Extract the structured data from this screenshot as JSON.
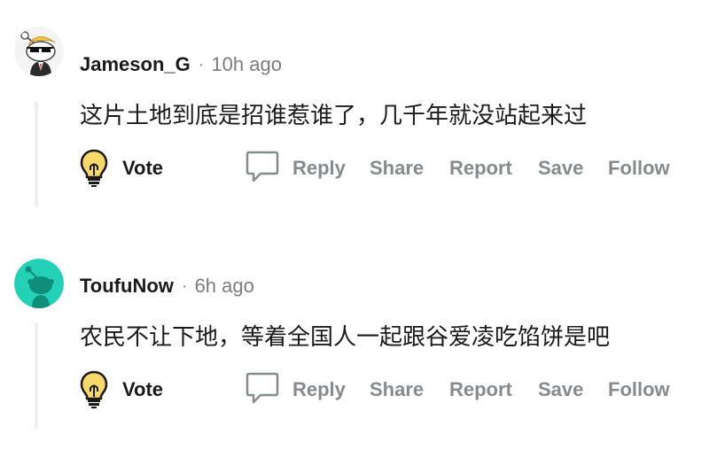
{
  "comments": [
    {
      "username": "Jameson_G",
      "separator": "·",
      "time": "10h ago",
      "text": "这片土地到底是招谁惹谁了，几千年就没站起来过",
      "avatar": "snoo-avatar-sunglasses",
      "actions": {
        "vote": "Vote",
        "reply": "Reply",
        "share": "Share",
        "report": "Report",
        "save": "Save",
        "follow": "Follow"
      }
    },
    {
      "username": "ToufuNow",
      "separator": "·",
      "time": "6h ago",
      "text": "农民不让下地，等着全国人一起跟谷爱凌吃馅饼是吧",
      "avatar": "snoo-avatar-teal",
      "actions": {
        "vote": "Vote",
        "reply": "Reply",
        "share": "Share",
        "report": "Report",
        "save": "Save",
        "follow": "Follow"
      }
    }
  ],
  "colors": {
    "text": "#1a1a1b",
    "muted": "#878a8c",
    "thread_line": "#edeff1",
    "teal_avatar": "#24d1b7"
  }
}
